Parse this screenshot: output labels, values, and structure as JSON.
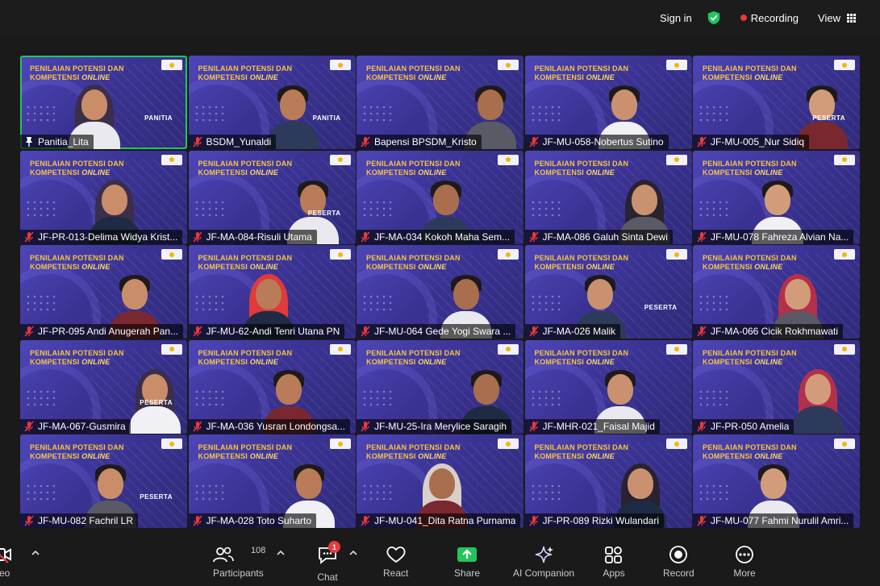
{
  "topbar": {
    "sign_in": "Sign in",
    "recording": "Recording",
    "view": "View",
    "icons": [
      "shield-check-icon",
      "recording-dot-icon",
      "grid-icon"
    ],
    "colors": {
      "shield": "#22c55e",
      "recording": "#e8393b"
    }
  },
  "banner": {
    "title_line1": "PENILAIAN POTENSI DAN",
    "title_line2a": "KOMPETENSI ",
    "title_line2b": "ONLINE"
  },
  "tiles": [
    {
      "name": "Panitia_Lita",
      "role": "PANITIA",
      "active": true,
      "mic": "pin"
    },
    {
      "name": "BSDM_Yunaldi",
      "role": "PANITIA",
      "mic": "muted"
    },
    {
      "name": "Bapensi BPSDM_Kristo",
      "role": "",
      "mic": "muted"
    },
    {
      "name": "JF-MU-058-Nobertus Sutino",
      "role": "",
      "mic": "muted"
    },
    {
      "name": "JF-MU-005_Nur Sidiq",
      "role": "PESERTA",
      "mic": "muted"
    },
    {
      "name": "JF-PR-013-Delima Widya Krist...",
      "role": "",
      "mic": "muted"
    },
    {
      "name": "JF-MA-084-Risuli Utama",
      "role": "PESERTA",
      "mic": "muted"
    },
    {
      "name": "JF-MA-034 Kokoh Maha Sem...",
      "role": "",
      "mic": "muted"
    },
    {
      "name": "JF-MA-086 Galuh Sinta Dewi",
      "role": "",
      "mic": "muted"
    },
    {
      "name": "JF-MU-078 Fahreza Alvian Na...",
      "role": "",
      "mic": "muted"
    },
    {
      "name": "JF-PR-095 Andi Anugerah Pan...",
      "role": "",
      "mic": "muted"
    },
    {
      "name": "JF-MU-62-Andi Tenri Utana PN",
      "role": "",
      "mic": "muted"
    },
    {
      "name": "JF-MU-064 Gede Yogi Swara ...",
      "role": "",
      "mic": "muted"
    },
    {
      "name": "JF-MA-026 Malik",
      "role": "PESERTA",
      "mic": "muted"
    },
    {
      "name": "JF-MA-066 Cicik Rokhmawati",
      "role": "",
      "mic": "muted"
    },
    {
      "name": "JF-MA-067-Gusmira",
      "role": "PESERTA",
      "mic": "muted"
    },
    {
      "name": "JF-MA-036 Yusran Londongsa...",
      "role": "",
      "mic": "muted"
    },
    {
      "name": "JF-MU-25-Ira Merylice Saragih",
      "role": "",
      "mic": "muted"
    },
    {
      "name": "JF-MHR-021_Faisal Majid",
      "role": "",
      "mic": "muted"
    },
    {
      "name": "JF-PR-050 Amelia",
      "role": "",
      "mic": "muted"
    },
    {
      "name": "JF-MU-082 Fachril LR",
      "role": "PESERTA",
      "mic": "muted"
    },
    {
      "name": "JF-MA-028 Toto Suharto",
      "role": "",
      "mic": "muted"
    },
    {
      "name": "JF-MU-041_Dita Ratna Purnama",
      "role": "",
      "mic": "muted"
    },
    {
      "name": "JF-PR-089 Rizki Wulandari",
      "role": "",
      "mic": "muted"
    },
    {
      "name": "JF-MU-077 Fahmi Nurulil Amri...",
      "role": "",
      "mic": "muted"
    }
  ],
  "toolbar": {
    "video": "ideo",
    "participants": "Participants",
    "participants_count": "108",
    "chat": "Chat",
    "chat_badge": "1",
    "react": "React",
    "share": "Share",
    "ai_companion": "AI Companion",
    "apps": "Apps",
    "record": "Record",
    "more": "More",
    "colors": {
      "share": "#22c55e",
      "muted": "#e8393b",
      "badge": "#e8393b"
    }
  }
}
